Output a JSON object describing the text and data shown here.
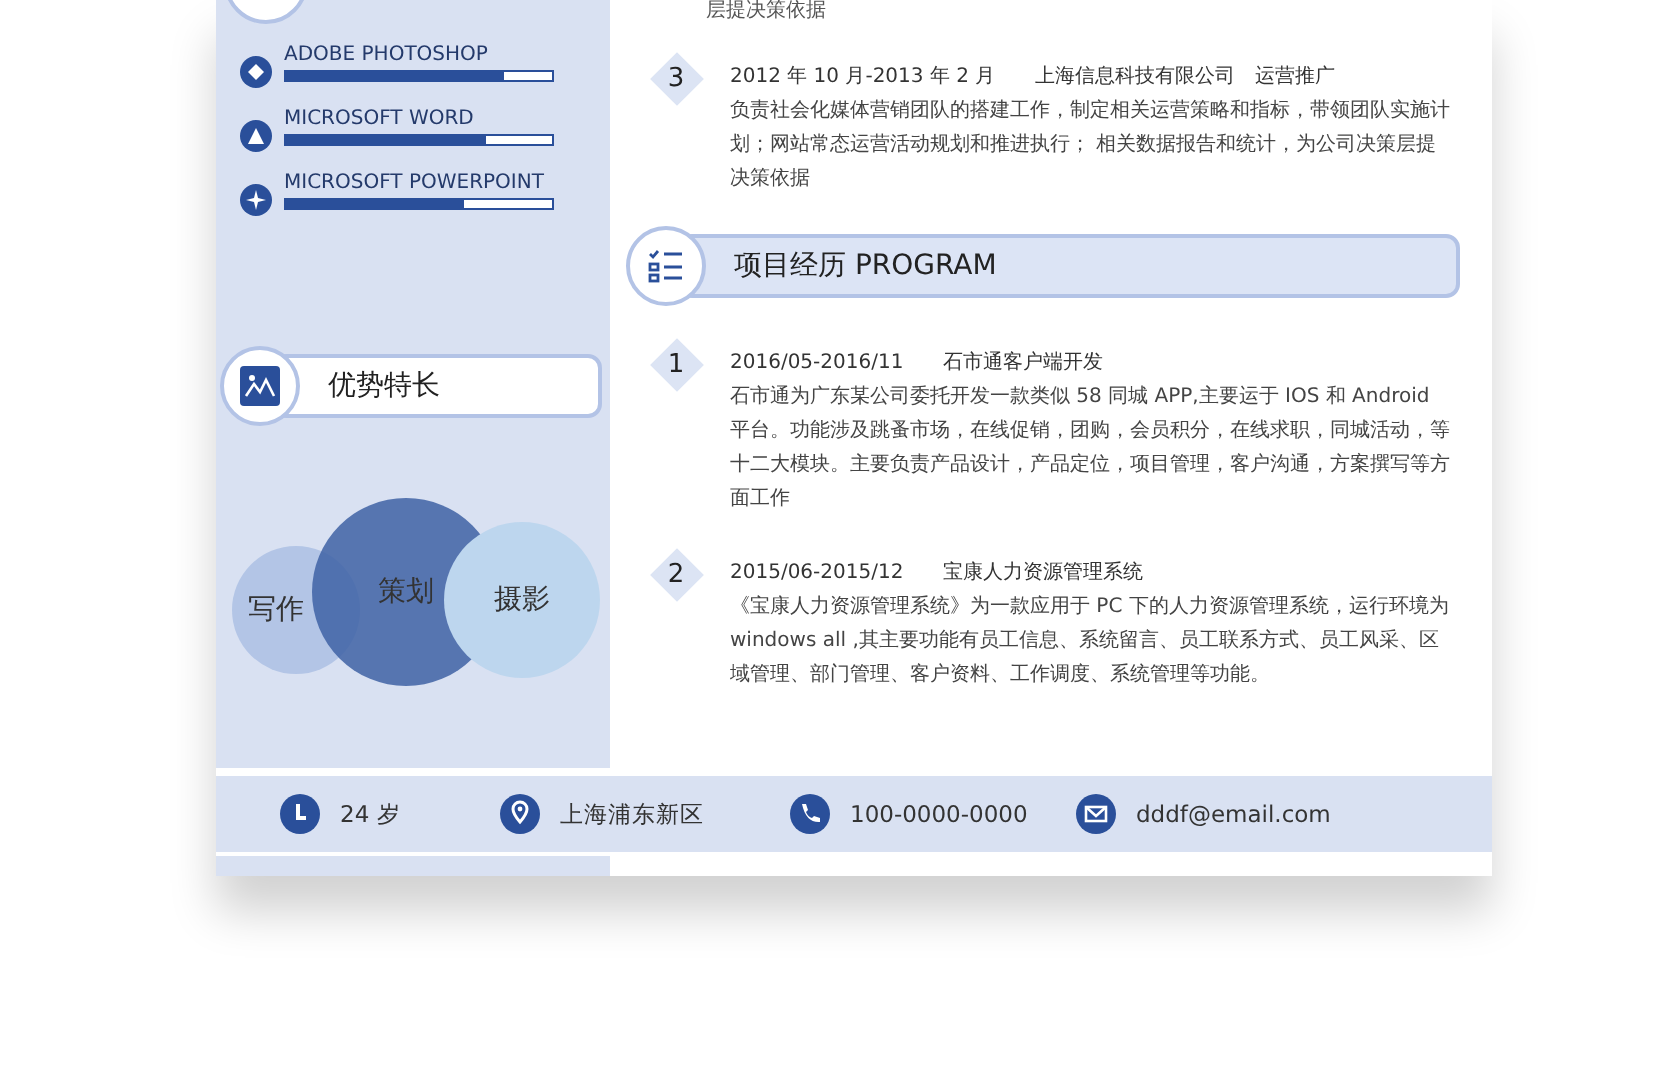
{
  "top_fragment": "层提决策依据",
  "skills": [
    {
      "name": "ADOBE PHOTOSHOP",
      "kind": "diamond",
      "level": 0.82
    },
    {
      "name": "MICROSOFT WORD",
      "kind": "triangle",
      "level": 0.75
    },
    {
      "name": "MICROSOFT POWERPOINT",
      "kind": "cross",
      "level": 0.67
    }
  ],
  "strengths": {
    "title": "优势特长",
    "circles": [
      {
        "label": "写作",
        "kind": "small"
      },
      {
        "label": "策划",
        "kind": "large"
      },
      {
        "label": "摄影",
        "kind": "medium"
      }
    ]
  },
  "work": [
    {
      "number": "3",
      "date": "2012 年 10 月-2013 年 2 月",
      "company": "上海信息科技有限公司",
      "role": "运营推广",
      "description": "负责社会化媒体营销团队的搭建工作，制定相关运营策略和指标，带领团队实施计划；网站常态运营活动规划和推进执行； 相关数据报告和统计，为公司决策层提决策依据"
    }
  ],
  "projects_section": {
    "title": "项目经历 PROGRAM"
  },
  "projects": [
    {
      "number": "1",
      "date": "2016/05-2016/11",
      "name": "石市通客户端开发",
      "description": "石市通为广东某公司委托开发一款类似 58 同城 APP,主要运于 IOS 和 Android 平台。功能涉及跳蚤市场，在线促销，团购，会员积分，在线求职，同城活动，等十二大模块。主要负责产品设计，产品定位，项目管理，客户沟通，方案撰写等方面工作"
    },
    {
      "number": "2",
      "date": "2015/06-2015/12",
      "name": "宝康人力资源管理系统",
      "description": "《宝康人力资源管理系统》为一款应用于 PC 下的人力资源管理系统，运行环境为 windows all ,其主要功能有员工信息、系统留言、员工联系方式、员工风采、区域管理、部门管理、客户资料、工作调度、系统管理等功能。"
    }
  ],
  "contacts": [
    {
      "kind": "age",
      "text": "24 岁"
    },
    {
      "kind": "location",
      "text": "上海浦东新区"
    },
    {
      "kind": "phone",
      "text": "100-0000-0000"
    },
    {
      "kind": "email",
      "text": "dddf@email.com"
    }
  ]
}
